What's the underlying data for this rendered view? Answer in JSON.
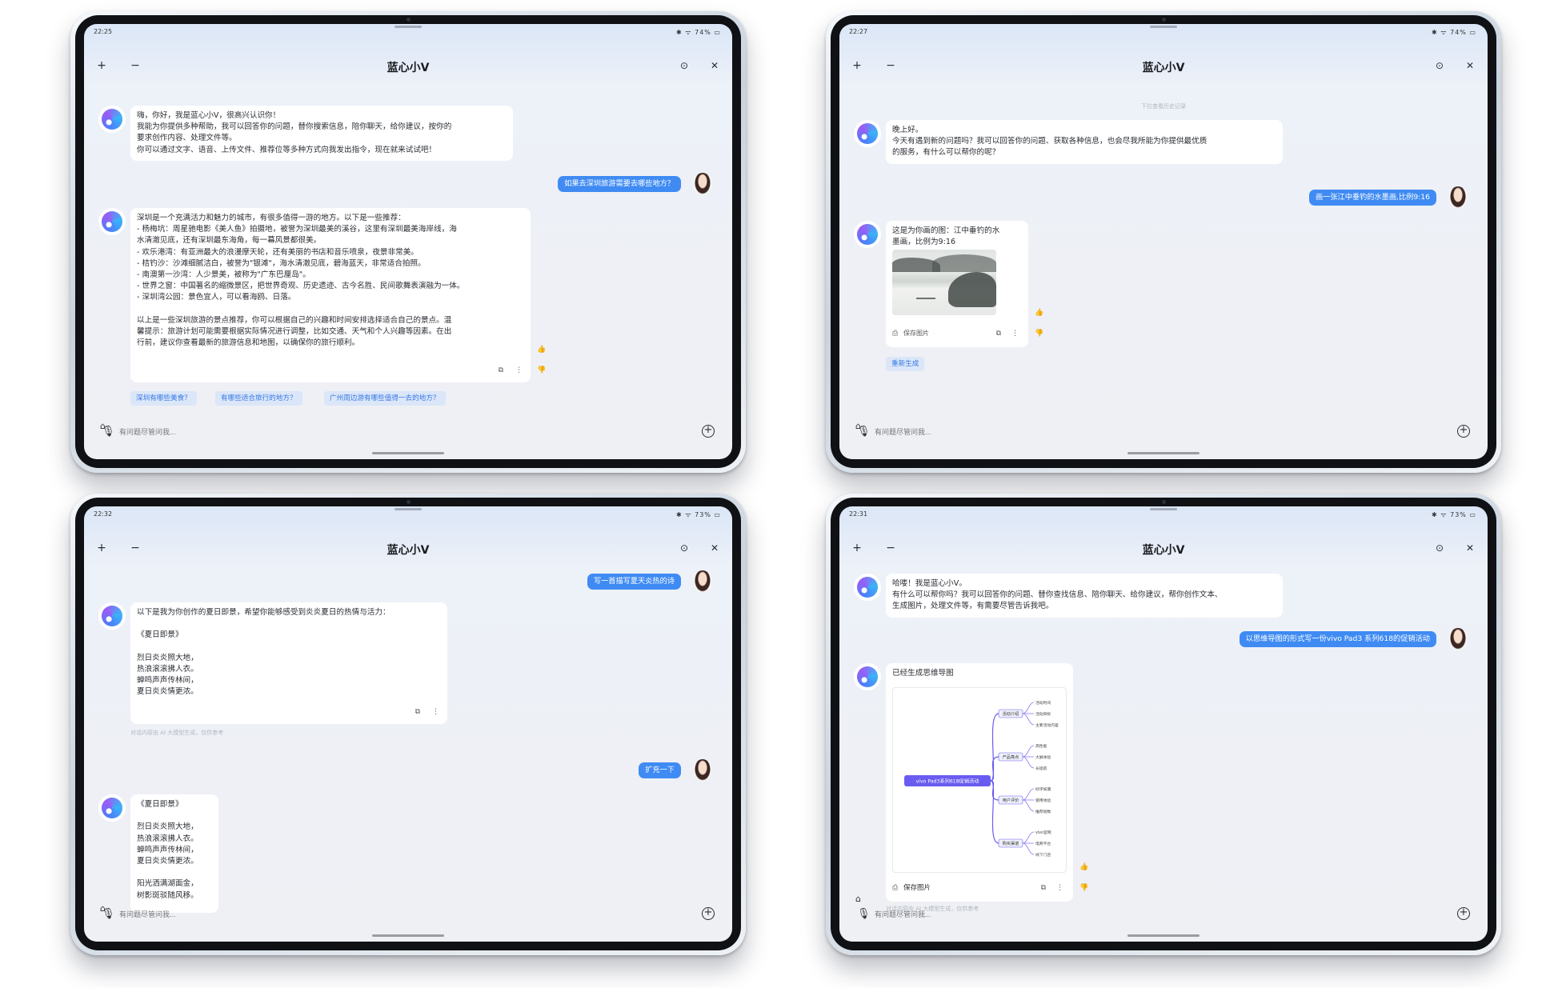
{
  "app": {
    "title": "蓝心小V",
    "input_placeholder": "有问题尽管问我...",
    "disclaimer": "对话内容由 AI 大模型生成，仅供参考"
  },
  "icons": {
    "new_chat": "+",
    "collapse": "−",
    "settings": "⊙",
    "close": "✕",
    "mic": "🎙",
    "add": "+",
    "attach": "⌂",
    "thumbs_up": "👍",
    "thumbs_down": "👎",
    "copy": "⧉",
    "more": "⋮",
    "save": "⎙"
  },
  "tablets": [
    {
      "status": {
        "time": "22:25",
        "right": "✱ ᯤ 74% ▭"
      },
      "greeting": "嗨，你好，我是蓝心小V，很高兴认识你！\n我能为你提供多种帮助，我可以回答你的问题，替你搜索信息，陪你聊天，给你建议，按你的\n要求创作内容、处理文件等。\n你可以通过文字、语音、上传文件、推荐位等多种方式向我发出指令，现在就来试试吧！",
      "user_msg": "如果去深圳旅游需要去哪些地方？",
      "answer": "深圳是一个充满活力和魅力的城市，有很多值得一游的地方。以下是一些推荐：\n- 杨梅坑：周星驰电影《美人鱼》拍摄地，被誉为深圳最美的溪谷，这里有深圳最美海岸线，海\n水清澈见底，还有深圳最东海角，每一幕风景都很美。\n- 欢乐港湾：有亚洲最大的浪漫摩天轮，还有美丽的书店和音乐喷泉，夜景非常美。\n- 桔钓沙：沙滩细腻洁白，被誉为\"银滩\"，海水清澈见底，碧海蓝天，非常适合拍照。\n- 南澳第一沙湾：人少景美，被称为\"广东巴厘岛\"。\n- 世界之窗：中国著名的缩微景区，把世界奇观、历史遗迹、古今名胜、民间歌舞表演融为一体。\n- 深圳湾公园：景色宜人，可以看海鸥、日落。\n\n以上是一些深圳旅游的景点推荐，你可以根据自己的兴趣和时间安排选择适合自己的景点。温\n馨提示：旅游计划可能需要根据实际情况进行调整，比如交通、天气和个人兴趣等因素。在出\n行前，建议你查看最新的旅游信息和地图，以确保你的旅行顺利。",
      "suggestions": [
        "深圳有哪些美食？",
        "有哪些适合旅行的地方？",
        "广州周边游有哪些值得一去的地方？"
      ]
    },
    {
      "status": {
        "time": "22:27",
        "right": "✱ ᯤ 74% ▭"
      },
      "history_hint": "下拉查看历史记录",
      "greeting": "晚上好。\n今天有遇到新的问题吗？我可以回答你的问题、获取各种信息，也会尽我所能为你提供最优质\n的服务，有什么可以帮你的呢？",
      "user_msg": "画一张江中垂钓的水墨画,比例9:16",
      "answer": "这是为你画的图：江中垂钓的水\n墨画，比例为9:16",
      "save_label": "保存图片",
      "regen_label": "重新生成"
    },
    {
      "status": {
        "time": "22:32",
        "right": "✱ ᯤ 73% ▭"
      },
      "user_msg": "写一首描写夏天炎热的诗",
      "answer": "以下是我为你创作的夏日即景，希望你能够感受到炎炎夏日的热情与活力：\n\n《夏日即景》\n\n烈日炎炎照大地，\n热浪滚滚拂人衣。\n蝉鸣声声传林间，\n夏日炎炎情更浓。",
      "user_msg2": "扩充一下",
      "answer2": "《夏日即景》\n\n烈日炎炎照大地，\n热浪滚滚拂人衣。\n蝉鸣声声传林间，\n夏日炎炎情更浓。\n\n阳光洒满湖面金，\n树影斑驳随风移。"
    },
    {
      "status": {
        "time": "22:31",
        "right": "✱ ᯤ 73% ▭"
      },
      "greeting": "哈喽！我是蓝心小V。\n有什么可以帮你吗？我可以回答你的问题、替你查找信息、陪你聊天、给你建议，帮你创作文本、\n生成图片，处理文件等，有需要尽管告诉我吧。",
      "user_msg": "以思维导图的形式写一份vivo Pad3 系列618的促销活动",
      "answer": "已经生成思维导图",
      "mindmap": {
        "root": "vivo Pad3系列618促销活动",
        "branches": [
          {
            "label": "活动介绍",
            "leaves": [
              "活动时间",
              "活动目标",
              "主要活动内容"
            ]
          },
          {
            "label": "产品亮点",
            "leaves": [
              "高性能",
              "大屏体验",
              "长续航"
            ]
          },
          {
            "label": "用户评价",
            "leaves": [
              "好评如潮",
              "使用体验",
              "推荐指数"
            ]
          },
          {
            "label": "购买渠道",
            "leaves": [
              "vivo官网",
              "电商平台",
              "线下门店"
            ]
          }
        ]
      },
      "save_label": "保存图片"
    }
  ]
}
